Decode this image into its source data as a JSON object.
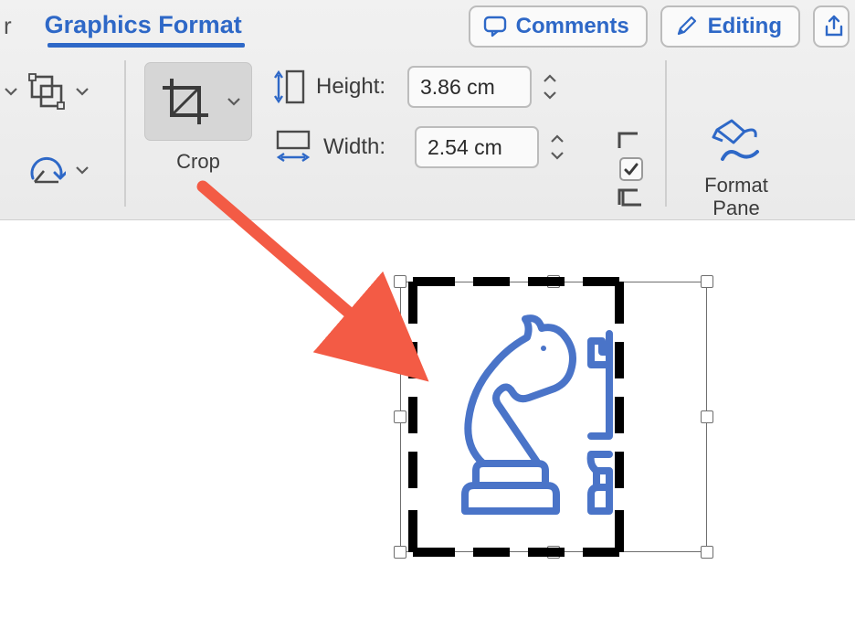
{
  "tabs": {
    "left_fragment": "r",
    "active": "Graphics Format"
  },
  "header_buttons": {
    "comments": "Comments",
    "editing": "Editing"
  },
  "crop": {
    "label": "Crop"
  },
  "size": {
    "height_label": "Height:",
    "width_label": "Width:",
    "height_value": "3.86 cm",
    "width_value": "2.54 cm"
  },
  "format_pane": {
    "line1": "Format",
    "line2": "Pane"
  },
  "colors": {
    "accent": "#2e68c7",
    "arrow": "#f35b45"
  }
}
